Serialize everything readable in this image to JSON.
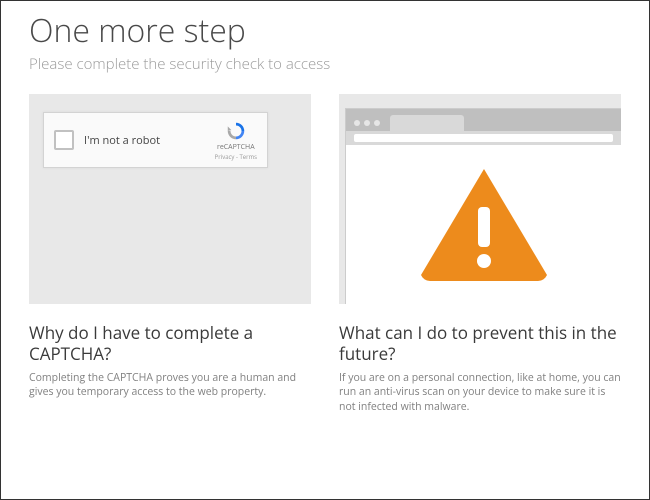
{
  "header": {
    "title": "One more step",
    "subtitle": "Please complete the security check to access"
  },
  "captcha": {
    "label": "I'm not a robot",
    "brand": "reCAPTCHA",
    "terms": "Privacy - Terms"
  },
  "info": {
    "left": {
      "title": "Why do I have to complete a CAPTCHA?",
      "body": "Completing the CAPTCHA proves you are a human and gives you temporary access to the web property."
    },
    "right": {
      "title": "What can I do to prevent this in the future?",
      "body": "If you are on a personal connection, like at home, you can run an anti-virus scan on your device to make sure it is not infected with malware."
    }
  },
  "colors": {
    "warning": "#ed8b1c"
  }
}
